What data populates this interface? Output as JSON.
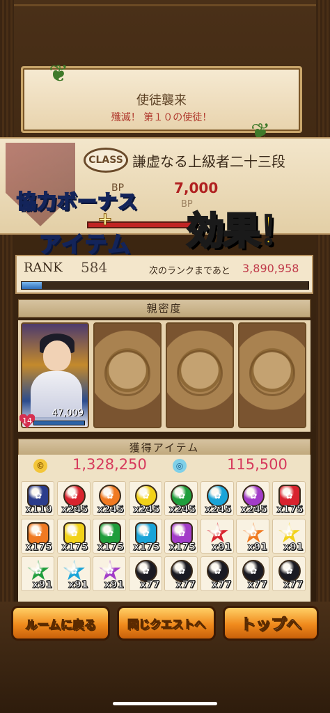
{
  "title_panel": {
    "main": "使徒襲来",
    "sub": "殲滅！ 第１０の使徒！"
  },
  "class_band": {
    "class_tag": "CLASS",
    "class_name": "謙虚なる上級者二十三段",
    "bp_label": "BP",
    "bp_value": "7,000",
    "ex_text": "BP"
  },
  "overlay": {
    "line1_a": "協",
    "line1_b": "力ボーナス",
    "plus": "+",
    "line2": "アイテム",
    "effect": "効果！"
  },
  "rank": {
    "label": "RANK",
    "value": "584",
    "next_label": "次のランクまであと",
    "next_value": "3,890,958",
    "progress": 0.07
  },
  "intimacy": {
    "header": "親密度",
    "hero": {
      "value": "47,009",
      "level": "14"
    }
  },
  "items": {
    "header": "獲得アイテム",
    "coins": "1,328,250",
    "tickets": "115,500",
    "rows": [
      [
        {
          "c": "#2b3d8c",
          "q": "x119",
          "s": "hex"
        },
        {
          "c": "#d8232e",
          "q": "x245"
        },
        {
          "c": "#f07a22",
          "q": "x245"
        },
        {
          "c": "#f2d21a",
          "q": "x245"
        },
        {
          "c": "#1f9e3c",
          "q": "x245"
        },
        {
          "c": "#1aa4d8",
          "q": "x245"
        },
        {
          "c": "#a23cc8",
          "q": "x245"
        },
        {
          "c": "#d8232e",
          "q": "x175",
          "s": "hex"
        }
      ],
      [
        {
          "c": "#f07a22",
          "q": "x175",
          "s": "hex"
        },
        {
          "c": "#f2d21a",
          "q": "x175",
          "s": "hex"
        },
        {
          "c": "#1f9e3c",
          "q": "x175",
          "s": "hex"
        },
        {
          "c": "#1aa4d8",
          "q": "x175",
          "s": "hex"
        },
        {
          "c": "#a23cc8",
          "q": "x175",
          "s": "hex"
        },
        {
          "c": "#d8232e",
          "q": "x91",
          "s": "star"
        },
        {
          "c": "#f07a22",
          "q": "x91",
          "s": "star"
        },
        {
          "c": "#f2d21a",
          "q": "x91",
          "s": "star"
        }
      ],
      [
        {
          "c": "#1f9e3c",
          "q": "x91",
          "s": "star"
        },
        {
          "c": "#1aa4d8",
          "q": "x91",
          "s": "star"
        },
        {
          "c": "#a23cc8",
          "q": "x91",
          "s": "star"
        },
        {
          "c": "#1a1a22",
          "q": "x77"
        },
        {
          "c": "#1a1a22",
          "q": "x77"
        },
        {
          "c": "#1a1a22",
          "q": "x77"
        },
        {
          "c": "#1a1a22",
          "q": "x77"
        },
        {
          "c": "#1a1a22",
          "q": "x77"
        }
      ]
    ]
  },
  "buttons": {
    "room": "ルームに戻る",
    "same_quest": "同じクエストへ",
    "top": "トップへ"
  }
}
